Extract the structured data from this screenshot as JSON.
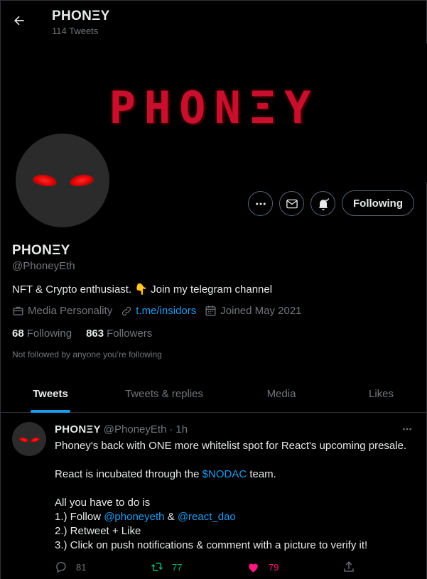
{
  "header": {
    "back_icon": "arrow-left-icon",
    "display_name": "PHONΞY",
    "tweet_count": "114 Tweets"
  },
  "banner": {
    "text": "PHONΞY",
    "accent_color": "#c8102e"
  },
  "actions": {
    "more_icon": "ellipsis-icon",
    "message_icon": "envelope-icon",
    "notification_icon": "bell-check-icon",
    "following_label": "Following"
  },
  "profile": {
    "name": "PHONΞY",
    "handle": "@PhoneyEth",
    "bio": "NFT & Crypto enthusiast. 👇 Join my telegram channel",
    "category": "Media Personality",
    "link": "t.me/insidors",
    "joined": "Joined May 2021",
    "following_count": "68",
    "following_label": "Following",
    "followers_count": "863",
    "followers_label": "Followers",
    "followed_note": "Not followed by anyone you’re following"
  },
  "tabs": [
    {
      "label": "Tweets",
      "active": true
    },
    {
      "label": "Tweets & replies",
      "active": false
    },
    {
      "label": "Media",
      "active": false
    },
    {
      "label": "Likes",
      "active": false
    }
  ],
  "tweet": {
    "name": "PHONΞY",
    "handle": "@PhoneyEth",
    "dot": "·",
    "time": "1h",
    "line1": "Phoney's back with ONE more whitelist spot for React's upcoming presale.",
    "line2_pre": "React is incubated through the ",
    "line2_link": "$NODAC",
    "line2_post": " team.",
    "line3": "All you have to do is",
    "line4_pre": "1.) Follow ",
    "line4_link1": "@phoneyeth",
    "line4_mid": " & ",
    "line4_link2": "@react_dao",
    "line5": "2.) Retweet + Like",
    "line6": "3.) Click on push notifications & comment with a picture to verify it!",
    "replies": "81",
    "retweets": "77",
    "likes": "79",
    "link_color": "#1d9bf0",
    "retweet_color": "#00ba7c",
    "like_color": "#f91880"
  }
}
